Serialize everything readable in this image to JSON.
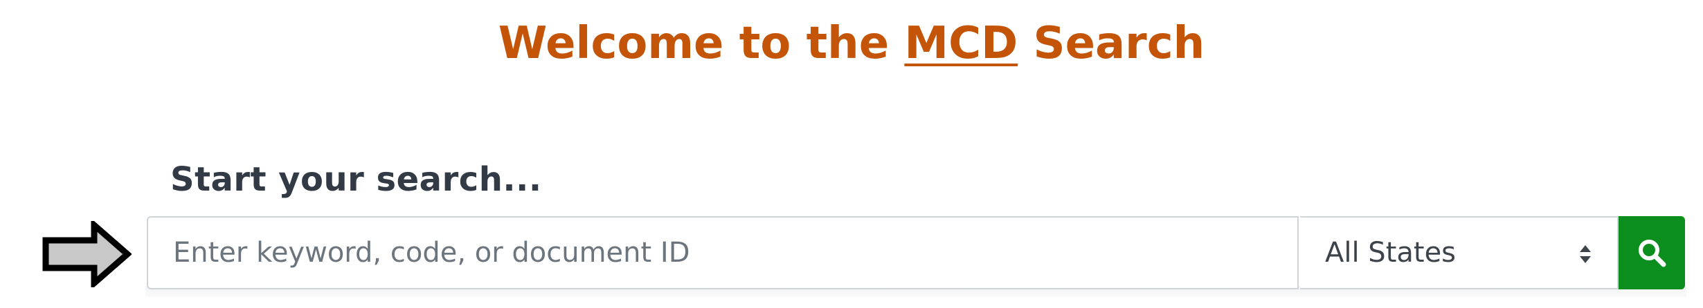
{
  "header": {
    "title_prefix": "Welcome to the ",
    "title_link": "MCD",
    "title_suffix": " Search"
  },
  "search": {
    "heading": "Start your search...",
    "placeholder": "Enter keyword, code, or document ID",
    "value": "",
    "state_select": {
      "selected": "All States"
    },
    "button_icon": "search-icon"
  },
  "pointer": {
    "icon": "right-arrow-icon"
  },
  "colors": {
    "title": "#c45508",
    "heading": "#323a45",
    "button": "#0b8e1d",
    "button_icon": "#ffffff",
    "border": "#cfd4d9",
    "arrow_fill": "#c8c8c8",
    "arrow_stroke": "#000000"
  }
}
